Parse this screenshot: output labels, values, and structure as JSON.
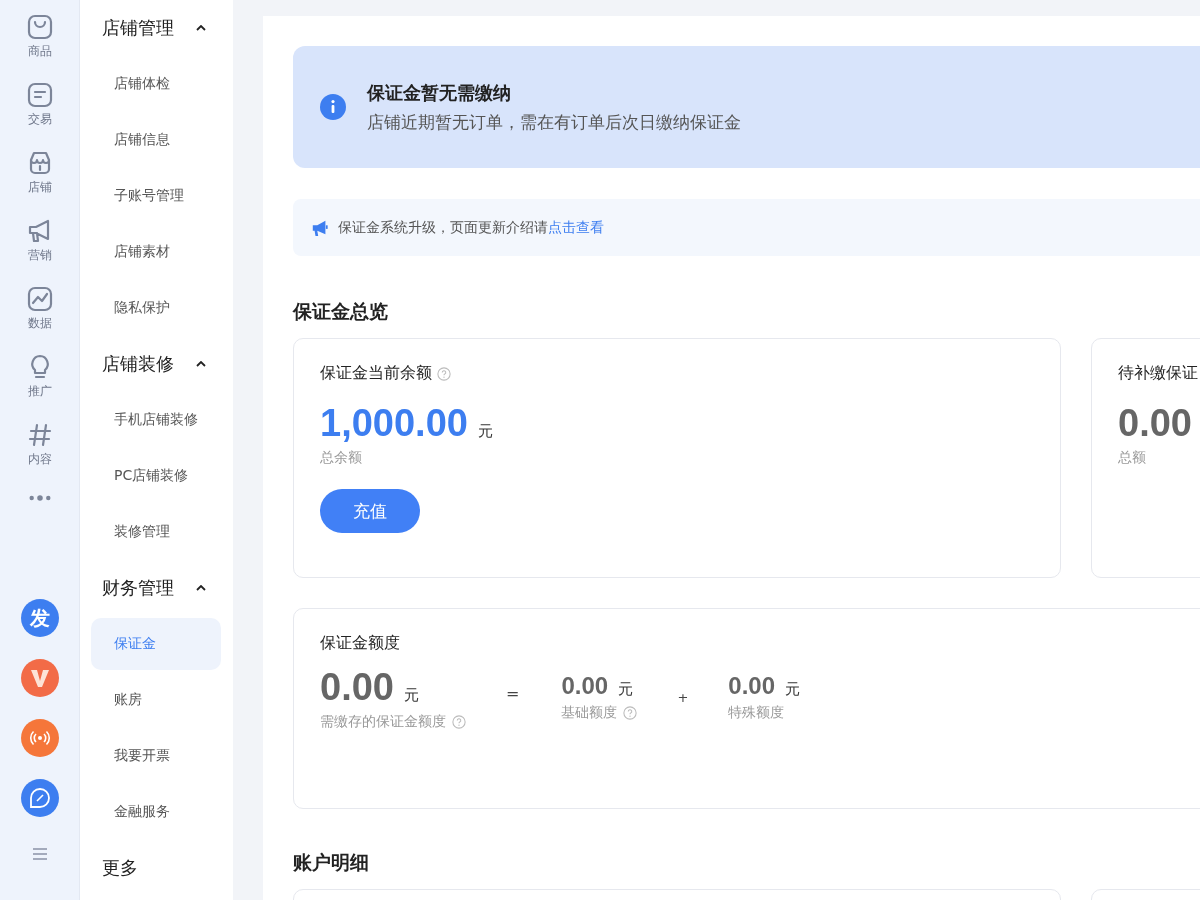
{
  "rail": {
    "items": [
      {
        "label": "商品"
      },
      {
        "label": "交易"
      },
      {
        "label": "店铺"
      },
      {
        "label": "营销"
      },
      {
        "label": "数据"
      },
      {
        "label": "推广"
      },
      {
        "label": "内容"
      }
    ],
    "apps": [
      {
        "kind": "text",
        "text": "发",
        "color": "#3d7ef0"
      },
      {
        "kind": "logo",
        "color": "#f26b47"
      },
      {
        "kind": "signal",
        "color": "#f5763a"
      },
      {
        "kind": "compass",
        "color": "#3d7ef0"
      }
    ]
  },
  "submenu": {
    "groups": [
      {
        "title": "店铺管理",
        "expanded": true,
        "items": [
          {
            "label": "店铺体检",
            "selected": false
          },
          {
            "label": "店铺信息",
            "selected": false
          },
          {
            "label": "子账号管理",
            "selected": false
          },
          {
            "label": "店铺素材",
            "selected": false
          },
          {
            "label": "隐私保护",
            "selected": false
          }
        ]
      },
      {
        "title": "店铺装修",
        "expanded": true,
        "items": [
          {
            "label": "手机店铺装修",
            "selected": false
          },
          {
            "label": "PC店铺装修",
            "selected": false
          },
          {
            "label": "装修管理",
            "selected": false
          }
        ]
      },
      {
        "title": "财务管理",
        "expanded": true,
        "items": [
          {
            "label": "保证金",
            "selected": true
          },
          {
            "label": "账房",
            "selected": false
          },
          {
            "label": "我要开票",
            "selected": false
          },
          {
            "label": "金融服务",
            "selected": false
          }
        ]
      }
    ],
    "more": "更多"
  },
  "banner": {
    "title": "保证金暂无需缴纳",
    "text": "店铺近期暂无订单，需在有订单后次日缴纳保证金"
  },
  "notice": {
    "text": "保证金系统升级，页面更新介绍请",
    "link": "点击查看"
  },
  "overview": {
    "heading": "保证金总览",
    "balance": {
      "title": "保证金当前余额",
      "help": true,
      "value": "1,000.00",
      "unit": "元",
      "label": "总余额",
      "button": "充值"
    },
    "pending": {
      "title": "待补缴保证",
      "value": "0.00",
      "label": "总额"
    }
  },
  "quota": {
    "title": "保证金额度",
    "total": {
      "value": "0.00",
      "unit": "元",
      "label": "需缴存的保证金额度",
      "help": true
    },
    "equals": "=",
    "base": {
      "value": "0.00",
      "unit": "元",
      "label": "基础额度",
      "help": true
    },
    "plus": "+",
    "special": {
      "value": "0.00",
      "unit": "元",
      "label": "特殊额度",
      "help": false
    }
  },
  "details": {
    "heading": "账户明细"
  }
}
